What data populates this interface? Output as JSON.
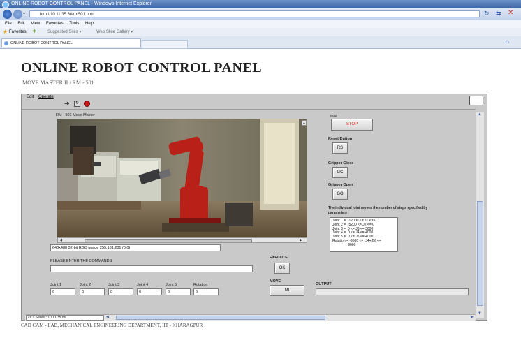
{
  "browser": {
    "window_title": "ONLINE ROBOT CONTROL PANEL - Windows Internet Explorer",
    "address": "http://10.11.35.86/rm501.html",
    "menu": [
      "File",
      "Edit",
      "View",
      "Favorites",
      "Tools",
      "Help"
    ],
    "favorites_label": "Favorites",
    "fav_links": [
      "Suggested Sites ▾",
      "Web Slice Gallery ▾"
    ],
    "tab_title": "ONLINE ROBOT CONTROL PANEL"
  },
  "page": {
    "title": "ONLINE ROBOT CONTROL PANEL",
    "subtitle": "MOVE MASTER II / RM - 501",
    "footer": "CAD CAM - LAB, MECHANICAL ENGINEERING DEPARTMENT, IIT - KHARAGPUR"
  },
  "applet": {
    "menu": [
      "Edit",
      "Operate"
    ],
    "camera_label": "RM - 501 Move Master",
    "image_info": "640x480 32-bit RGB image 255,181,201    (0,0)",
    "stop_section": "stop",
    "stop_button": "STOP",
    "reset_section": "Reset Button",
    "reset_button": "RS",
    "gripper_close_section": "Gripper Close",
    "gripper_close_button": "GC",
    "gripper_open_section": "Gripper Open",
    "gripper_open_button": "GO",
    "info_text": "The individual joint moves the number of steps specified by parameters",
    "limits": "Joint 1 =  -12000 <= J1 <= 0\nJoint 2 =  -5200 <= J2 <= 0\nJoint 3 =  0 <= J3 <= 3600\nJoint 4 =  0 <= J4 <= 4000\nJoint 5 =  0 <= J5 <= 4000\nRotation = -9600 <= (J4+J5) <=\n                9600",
    "command_label": "PLEASE ENTER THE COMMANDS",
    "command_value": "",
    "execute_section": "EXECUTE",
    "execute_button": "OK",
    "move_section": "MOVE",
    "move_button": "MI",
    "output_label": "OUTPUT",
    "output_value": "",
    "joints": [
      {
        "label": "Joint 1",
        "value": "0"
      },
      {
        "label": "Joint 2",
        "value": "0"
      },
      {
        "label": "Joint 3",
        "value": "0"
      },
      {
        "label": "Joint 4",
        "value": "0"
      },
      {
        "label": "Joint 5",
        "value": "0"
      },
      {
        "label": "Rotation",
        "value": "0"
      }
    ],
    "server_status": "<C> Server: 10.11.35.86",
    "stop_color": "#e0261f"
  }
}
